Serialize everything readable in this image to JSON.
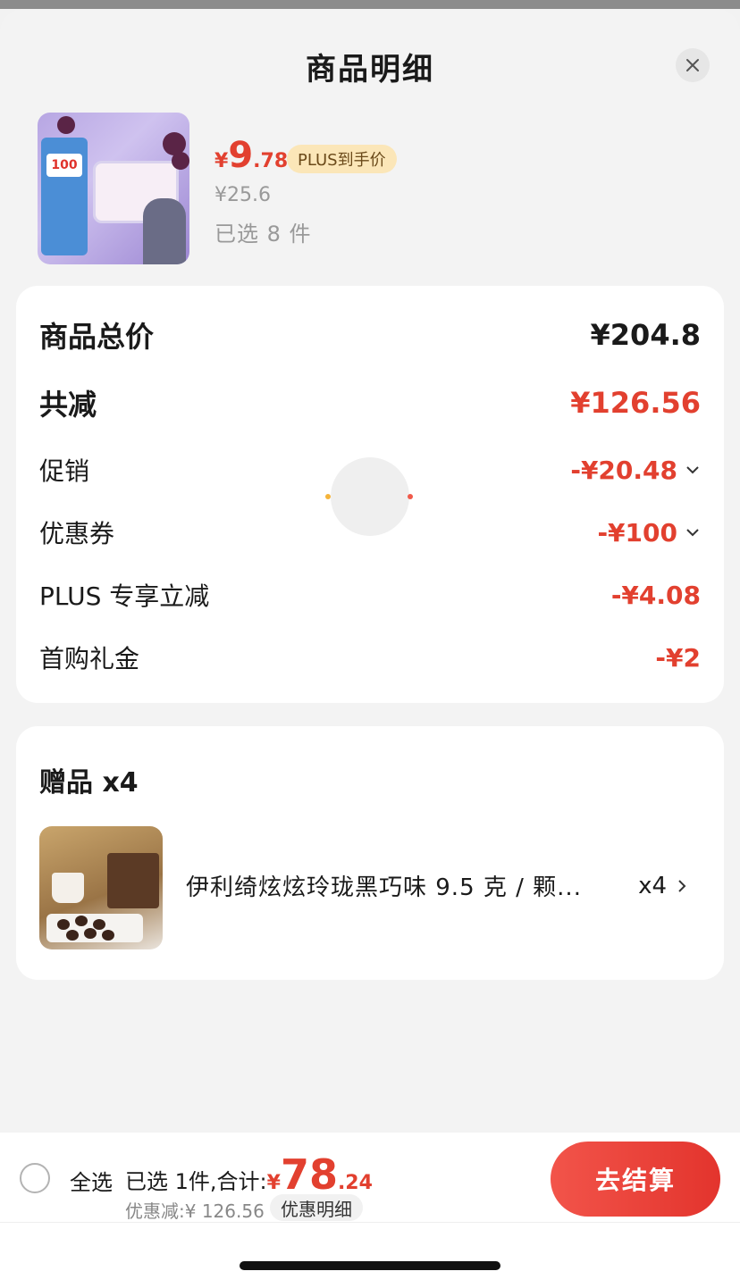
{
  "header": {
    "title": "商品明细"
  },
  "product": {
    "price_yen": "¥",
    "price_int": "9",
    "price_dec": ".78",
    "plus_tag": "PLUS到手价",
    "original_price": "¥25.6",
    "selected": "已选 8 件",
    "thumb_badge": "100"
  },
  "breakdown": {
    "total": {
      "label": "商品总价",
      "value": "¥204.8"
    },
    "reduction": {
      "label": "共减",
      "value": "¥126.56"
    },
    "promotion": {
      "label": "促销",
      "value": "-¥20.48"
    },
    "coupon": {
      "label": "优惠券",
      "value": "-¥100"
    },
    "plus_discount": {
      "label": "PLUS 专享立减",
      "value": "-¥4.08"
    },
    "first_gift": {
      "label": "首购礼金",
      "value": "-¥2"
    }
  },
  "gifts": {
    "title": "赠品 x4",
    "item_name": "伊利绮炫炫玲珑黑巧味 9.5 克 / 颗...",
    "item_qty": "x4"
  },
  "footer": {
    "select_all": "全选",
    "summary_text": "已选 1件,合计:",
    "total_yen": "¥",
    "total_int": "78",
    "total_dec": ".24",
    "discount_text": "优惠减:¥ 126.56",
    "detail_label": "优惠明细",
    "checkout_label": "去结算"
  },
  "colors": {
    "accent_red": "#e2402f",
    "plus_tag_bg": "#fbe6b8"
  }
}
